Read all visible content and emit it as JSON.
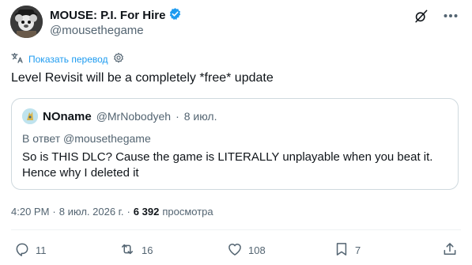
{
  "author": {
    "display_name": "MOUSE: P.I. For Hire",
    "handle": "@mousethegame",
    "verified": true
  },
  "translate_label": "Показать перевод",
  "tweet_text": "Level Revisit will be a completely *free* update",
  "quote": {
    "name": "NOname",
    "handle": "@MrNobodyeh",
    "separator": "·",
    "date": "8 июл.",
    "reply_to": "В ответ @mousethegame",
    "text": "So is THIS DLC? Cause the game is LITERALLY unplayable when you beat it. Hence why I deleted it"
  },
  "meta": {
    "time": "4:20 PM",
    "separator": "·",
    "date": "8 июл. 2026 г.",
    "views_count": "6 392",
    "views_label": "просмотра"
  },
  "actions": {
    "replies": "11",
    "reposts": "16",
    "likes": "108",
    "bookmarks": "7"
  },
  "colors": {
    "accent": "#1d9bf0",
    "text": "#0f1419",
    "muted": "#536471",
    "border": "#cfd9de"
  },
  "icons": [
    "grok-icon",
    "more-icon",
    "translate-settings-icon",
    "reply-icon",
    "repost-icon",
    "like-icon",
    "bookmark-icon",
    "share-icon",
    "verified-badge-icon"
  ]
}
